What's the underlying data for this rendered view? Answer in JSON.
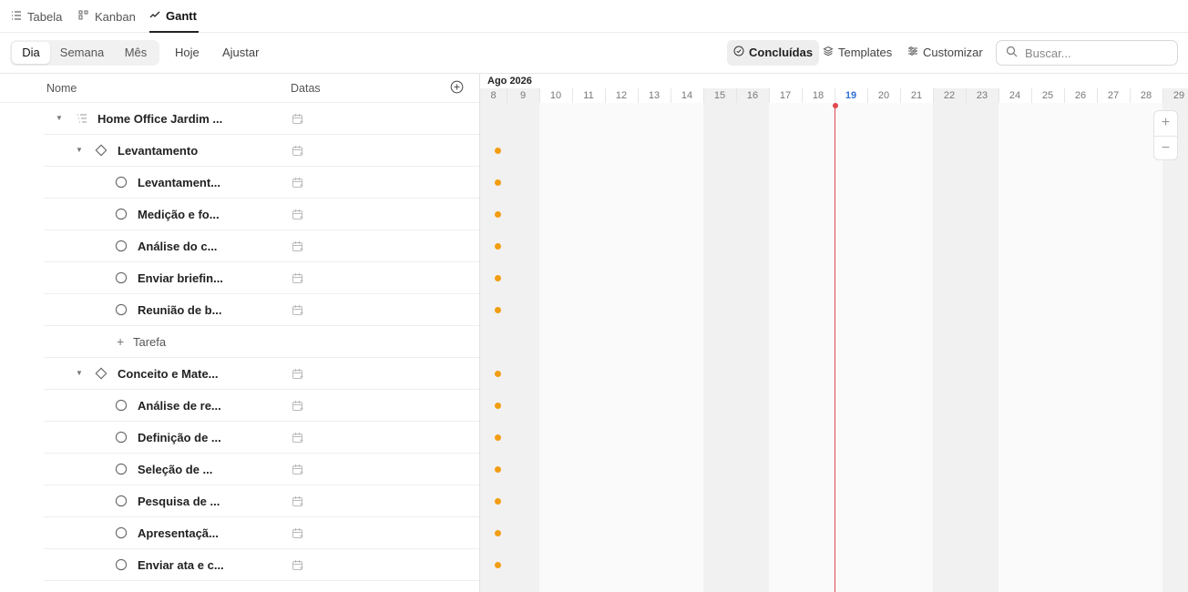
{
  "view_tabs": [
    {
      "label": "Tabela",
      "icon": "list-icon"
    },
    {
      "label": "Kanban",
      "icon": "kanban-icon"
    },
    {
      "label": "Gantt",
      "icon": "chart-line-icon",
      "active": true
    }
  ],
  "toolbar": {
    "scale": [
      "Dia",
      "Semana",
      "Mês"
    ],
    "scale_active": "Dia",
    "today_label": "Hoje",
    "fit_label": "Ajustar",
    "completed_label": "Concluídas",
    "templates_label": "Templates",
    "customize_label": "Customizar",
    "search_placeholder": "Buscar..."
  },
  "table_header": {
    "name": "Nome",
    "dates": "Datas"
  },
  "rows": [
    {
      "label": "Home Office Jardim ...",
      "kind": "project"
    },
    {
      "label": "Levantamento",
      "kind": "phase"
    },
    {
      "label": "Levantament...",
      "kind": "task"
    },
    {
      "label": "Medição e fo...",
      "kind": "task"
    },
    {
      "label": "Análise do c...",
      "kind": "task"
    },
    {
      "label": "Enviar briefin...",
      "kind": "task"
    },
    {
      "label": "Reunião de b...",
      "kind": "task"
    },
    {
      "label": "Tarefa",
      "kind": "add"
    },
    {
      "label": "Conceito e Mate...",
      "kind": "phase"
    },
    {
      "label": "Análise de re...",
      "kind": "task"
    },
    {
      "label": "Definição de ...",
      "kind": "task"
    },
    {
      "label": "Seleção de ...",
      "kind": "task"
    },
    {
      "label": "Pesquisa de ...",
      "kind": "task"
    },
    {
      "label": "Apresentaçã...",
      "kind": "task"
    },
    {
      "label": "Enviar ata e c...",
      "kind": "task"
    }
  ],
  "gantt": {
    "month_label": "Ago 2026",
    "days": [
      "8",
      "9",
      "10",
      "11",
      "12",
      "13",
      "14",
      "15",
      "16",
      "17",
      "18",
      "19",
      "20",
      "21",
      "22",
      "23",
      "24",
      "25",
      "26",
      "27",
      "28",
      "29"
    ],
    "today": "19",
    "weekend_days": [
      "8",
      "9",
      "15",
      "16",
      "22",
      "23",
      "29"
    ],
    "milestone_color": "#f29d12",
    "today_color": "#e34850",
    "zoom_in": "+",
    "zoom_out": "−"
  }
}
